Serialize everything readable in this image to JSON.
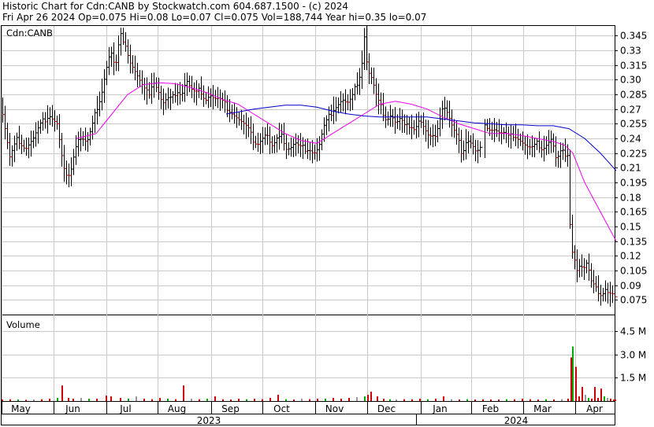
{
  "header": {
    "line1": "Historic Chart for Cdn:CANB by Stockwatch.com 604.687.1500 - (c) 2024",
    "line2": "Fri Apr 26 2024   Op=0.075   Hi=0.08   Lo=0.07   Cl=0.075   Vol=188,744   Year hi=0.35   lo=0.07"
  },
  "chart_data": [
    {
      "type": "line",
      "label": "Cdn:CANB",
      "y_ticks": [
        "0.345",
        "0.33",
        "0.315",
        "0.30",
        "0.285",
        "0.27",
        "0.255",
        "0.24",
        "0.225",
        "0.21",
        "0.195",
        "0.18",
        "0.165",
        "0.15",
        "0.135",
        "0.12",
        "0.105",
        "0.09",
        "0.075"
      ],
      "ylim": [
        0.06,
        0.355
      ],
      "grid": true,
      "price_points": [
        [
          0,
          0.27
        ],
        [
          10,
          0.22
        ],
        [
          20,
          0.24
        ],
        [
          30,
          0.23
        ],
        [
          40,
          0.24
        ],
        [
          50,
          0.255
        ],
        [
          60,
          0.265
        ],
        [
          70,
          0.255
        ],
        [
          78,
          0.21
        ],
        [
          84,
          0.195
        ],
        [
          90,
          0.22
        ],
        [
          96,
          0.24
        ],
        [
          102,
          0.24
        ],
        [
          108,
          0.235
        ],
        [
          114,
          0.25
        ],
        [
          120,
          0.27
        ],
        [
          126,
          0.285
        ],
        [
          132,
          0.31
        ],
        [
          138,
          0.33
        ],
        [
          144,
          0.31
        ],
        [
          150,
          0.345
        ],
        [
          156,
          0.34
        ],
        [
          162,
          0.32
        ],
        [
          168,
          0.31
        ],
        [
          174,
          0.3
        ],
        [
          180,
          0.29
        ],
        [
          186,
          0.285
        ],
        [
          192,
          0.3
        ],
        [
          198,
          0.29
        ],
        [
          204,
          0.275
        ],
        [
          210,
          0.28
        ],
        [
          216,
          0.28
        ],
        [
          222,
          0.29
        ],
        [
          228,
          0.285
        ],
        [
          234,
          0.3
        ],
        [
          240,
          0.29
        ],
        [
          246,
          0.285
        ],
        [
          252,
          0.29
        ],
        [
          258,
          0.28
        ],
        [
          264,
          0.285
        ],
        [
          270,
          0.28
        ],
        [
          276,
          0.28
        ],
        [
          282,
          0.275
        ],
        [
          288,
          0.27
        ],
        [
          294,
          0.265
        ],
        [
          300,
          0.26
        ],
        [
          306,
          0.255
        ],
        [
          312,
          0.25
        ],
        [
          318,
          0.24
        ],
        [
          324,
          0.235
        ],
        [
          330,
          0.24
        ],
        [
          336,
          0.245
        ],
        [
          342,
          0.23
        ],
        [
          348,
          0.235
        ],
        [
          354,
          0.25
        ],
        [
          360,
          0.23
        ],
        [
          366,
          0.23
        ],
        [
          372,
          0.235
        ],
        [
          378,
          0.23
        ],
        [
          384,
          0.23
        ],
        [
          390,
          0.23
        ],
        [
          396,
          0.225
        ],
        [
          402,
          0.23
        ],
        [
          408,
          0.25
        ],
        [
          414,
          0.26
        ],
        [
          420,
          0.27
        ],
        [
          426,
          0.275
        ],
        [
          432,
          0.28
        ],
        [
          438,
          0.275
        ],
        [
          444,
          0.28
        ],
        [
          450,
          0.295
        ],
        [
          456,
          0.31
        ],
        [
          460,
          0.345
        ],
        [
          464,
          0.31
        ],
        [
          470,
          0.3
        ],
        [
          476,
          0.28
        ],
        [
          482,
          0.27
        ],
        [
          488,
          0.26
        ],
        [
          494,
          0.265
        ],
        [
          500,
          0.255
        ],
        [
          506,
          0.26
        ],
        [
          512,
          0.25
        ],
        [
          518,
          0.255
        ],
        [
          524,
          0.25
        ],
        [
          530,
          0.26
        ],
        [
          536,
          0.25
        ],
        [
          542,
          0.24
        ],
        [
          548,
          0.24
        ],
        [
          554,
          0.255
        ],
        [
          560,
          0.275
        ],
        [
          566,
          0.265
        ],
        [
          572,
          0.25
        ],
        [
          578,
          0.24
        ],
        [
          584,
          0.225
        ],
        [
          590,
          0.24
        ],
        [
          596,
          0.235
        ],
        [
          602,
          0.225
        ],
        [
          608,
          0.23
        ],
        [
          614,
          0.255
        ],
        [
          620,
          0.25
        ],
        [
          626,
          0.25
        ],
        [
          632,
          0.245
        ],
        [
          638,
          0.245
        ],
        [
          644,
          0.24
        ],
        [
          650,
          0.245
        ],
        [
          656,
          0.24
        ],
        [
          662,
          0.235
        ],
        [
          668,
          0.23
        ],
        [
          674,
          0.23
        ],
        [
          680,
          0.235
        ],
        [
          686,
          0.23
        ],
        [
          692,
          0.235
        ],
        [
          698,
          0.24
        ],
        [
          704,
          0.215
        ],
        [
          708,
          0.225
        ],
        [
          712,
          0.225
        ],
        [
          718,
          0.225
        ],
        [
          722,
          0.13
        ],
        [
          726,
          0.12
        ],
        [
          730,
          0.105
        ],
        [
          734,
          0.11
        ],
        [
          738,
          0.105
        ],
        [
          742,
          0.11
        ],
        [
          746,
          0.1
        ],
        [
          750,
          0.095
        ],
        [
          754,
          0.09
        ],
        [
          758,
          0.08
        ],
        [
          762,
          0.08
        ],
        [
          766,
          0.085
        ],
        [
          770,
          0.08
        ],
        [
          774,
          0.08
        ],
        [
          778,
          0.075
        ]
      ],
      "ma_short_points": [
        [
          95,
          0.24
        ],
        [
          120,
          0.245
        ],
        [
          140,
          0.265
        ],
        [
          160,
          0.285
        ],
        [
          180,
          0.295
        ],
        [
          200,
          0.297
        ],
        [
          220,
          0.296
        ],
        [
          240,
          0.292
        ],
        [
          260,
          0.287
        ],
        [
          280,
          0.28
        ],
        [
          300,
          0.275
        ],
        [
          320,
          0.265
        ],
        [
          340,
          0.255
        ],
        [
          360,
          0.245
        ],
        [
          380,
          0.238
        ],
        [
          400,
          0.235
        ],
        [
          420,
          0.245
        ],
        [
          440,
          0.255
        ],
        [
          460,
          0.265
        ],
        [
          480,
          0.275
        ],
        [
          500,
          0.278
        ],
        [
          520,
          0.275
        ],
        [
          540,
          0.27
        ],
        [
          560,
          0.262
        ],
        [
          580,
          0.255
        ],
        [
          600,
          0.25
        ],
        [
          620,
          0.245
        ],
        [
          640,
          0.245
        ],
        [
          660,
          0.243
        ],
        [
          680,
          0.24
        ],
        [
          700,
          0.237
        ],
        [
          715,
          0.233
        ],
        [
          725,
          0.225
        ],
        [
          740,
          0.195
        ],
        [
          760,
          0.165
        ],
        [
          780,
          0.135
        ]
      ],
      "ma_long_points": [
        [
          285,
          0.265
        ],
        [
          300,
          0.267
        ],
        [
          320,
          0.27
        ],
        [
          340,
          0.272
        ],
        [
          360,
          0.274
        ],
        [
          380,
          0.274
        ],
        [
          400,
          0.272
        ],
        [
          420,
          0.268
        ],
        [
          440,
          0.265
        ],
        [
          460,
          0.263
        ],
        [
          480,
          0.262
        ],
        [
          500,
          0.262
        ],
        [
          520,
          0.262
        ],
        [
          540,
          0.262
        ],
        [
          560,
          0.26
        ],
        [
          580,
          0.258
        ],
        [
          600,
          0.256
        ],
        [
          620,
          0.255
        ],
        [
          640,
          0.254
        ],
        [
          660,
          0.254
        ],
        [
          680,
          0.253
        ],
        [
          700,
          0.253
        ],
        [
          720,
          0.25
        ],
        [
          740,
          0.24
        ],
        [
          760,
          0.225
        ],
        [
          780,
          0.207
        ]
      ]
    },
    {
      "type": "bar",
      "label": "Volume",
      "y_ticks": [
        "4.5 M",
        "3.0 M",
        "1.5 M"
      ],
      "ylim": [
        0,
        5.5
      ],
      "volume_points": [
        [
          0,
          0.1
        ],
        [
          10,
          0.12
        ],
        [
          20,
          0.1
        ],
        [
          30,
          0.08
        ],
        [
          40,
          0.1
        ],
        [
          50,
          0.12
        ],
        [
          60,
          0.15
        ],
        [
          70,
          0.2
        ],
        [
          76,
          1.0
        ],
        [
          84,
          0.2
        ],
        [
          90,
          0.15
        ],
        [
          100,
          0.2
        ],
        [
          110,
          0.15
        ],
        [
          120,
          0.15
        ],
        [
          132,
          0.35
        ],
        [
          138,
          0.3
        ],
        [
          150,
          0.2
        ],
        [
          160,
          0.15
        ],
        [
          170,
          0.3
        ],
        [
          180,
          0.15
        ],
        [
          190,
          0.12
        ],
        [
          200,
          0.2
        ],
        [
          210,
          0.15
        ],
        [
          220,
          0.12
        ],
        [
          230,
          1.0
        ],
        [
          240,
          0.15
        ],
        [
          250,
          0.12
        ],
        [
          260,
          0.15
        ],
        [
          270,
          0.3
        ],
        [
          280,
          0.12
        ],
        [
          290,
          0.1
        ],
        [
          300,
          0.15
        ],
        [
          310,
          0.12
        ],
        [
          320,
          0.15
        ],
        [
          330,
          0.12
        ],
        [
          340,
          0.2
        ],
        [
          350,
          0.4
        ],
        [
          360,
          0.12
        ],
        [
          370,
          0.1
        ],
        [
          380,
          0.15
        ],
        [
          390,
          0.12
        ],
        [
          400,
          0.15
        ],
        [
          410,
          0.15
        ],
        [
          420,
          0.2
        ],
        [
          430,
          0.15
        ],
        [
          440,
          0.2
        ],
        [
          450,
          0.25
        ],
        [
          460,
          0.3
        ],
        [
          464,
          0.4
        ],
        [
          468,
          0.6
        ],
        [
          476,
          0.3
        ],
        [
          484,
          0.15
        ],
        [
          492,
          0.12
        ],
        [
          500,
          0.1
        ],
        [
          510,
          0.12
        ],
        [
          520,
          0.12
        ],
        [
          530,
          0.15
        ],
        [
          540,
          0.12
        ],
        [
          550,
          0.15
        ],
        [
          560,
          0.3
        ],
        [
          570,
          0.12
        ],
        [
          580,
          0.1
        ],
        [
          590,
          0.12
        ],
        [
          600,
          0.1
        ],
        [
          610,
          0.12
        ],
        [
          620,
          0.1
        ],
        [
          630,
          0.1
        ],
        [
          640,
          0.12
        ],
        [
          650,
          0.12
        ],
        [
          660,
          0.15
        ],
        [
          670,
          0.12
        ],
        [
          680,
          0.1
        ],
        [
          690,
          0.12
        ],
        [
          700,
          0.1
        ],
        [
          710,
          0.12
        ],
        [
          718,
          0.15
        ],
        [
          722,
          2.8
        ],
        [
          724,
          3.5
        ],
        [
          728,
          2.2
        ],
        [
          732,
          0.3
        ],
        [
          736,
          0.9
        ],
        [
          740,
          0.4
        ],
        [
          744,
          0.2
        ],
        [
          748,
          0.15
        ],
        [
          752,
          0.9
        ],
        [
          756,
          0.2
        ],
        [
          760,
          0.8
        ],
        [
          764,
          0.3
        ],
        [
          768,
          0.2
        ],
        [
          772,
          0.15
        ],
        [
          776,
          0.1
        ],
        [
          778,
          0.1
        ]
      ]
    }
  ],
  "x_axis": {
    "months": [
      "May",
      "Jun",
      "Jul",
      "Aug",
      "Sep",
      "Oct",
      "Nov",
      "Dec",
      "Jan",
      "Feb",
      "Mar",
      "Apr"
    ],
    "years": [
      "2023",
      "2024"
    ]
  },
  "colors": {
    "up": "#000000",
    "down": "#cc0000",
    "ma_short": "#ee00ee",
    "ma_long": "#0000cc",
    "vol_up": "#cc0000",
    "vol_alt": "#00aa00",
    "vol_neutral": "#999999",
    "grid": "#c8c8c8"
  }
}
